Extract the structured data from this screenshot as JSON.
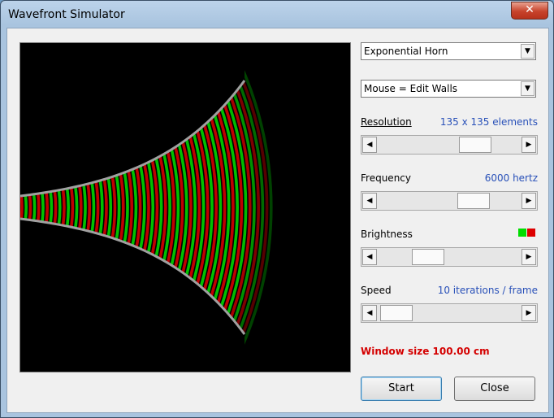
{
  "window": {
    "title": "Wavefront Simulator",
    "close_glyph": "✕"
  },
  "shape_select": {
    "value": "Exponential Horn"
  },
  "mouse_select": {
    "value": "Mouse = Edit Walls"
  },
  "resolution": {
    "label": "Resolution",
    "value": "135 x 135 elements",
    "level": 0.73
  },
  "frequency": {
    "label": "Frequency",
    "value": "6000 hertz",
    "level": 0.72
  },
  "brightness": {
    "label": "Brightness",
    "level": 0.31,
    "swatch_colors": [
      "#00dd00",
      "#dd0000"
    ]
  },
  "speed": {
    "label": "Speed",
    "value": "10 iterations / frame",
    "level": 0.03
  },
  "window_size": "Window size 100.00 cm",
  "buttons": {
    "start": "Start",
    "close": "Close"
  },
  "icons": {
    "dropdown": "chevron-down-icon",
    "left": "arrow-left-icon",
    "right": "arrow-right-icon"
  },
  "colors": {
    "wave_positive": "#00c000",
    "wave_negative": "#c00000",
    "wall": "#a0a0a0"
  }
}
